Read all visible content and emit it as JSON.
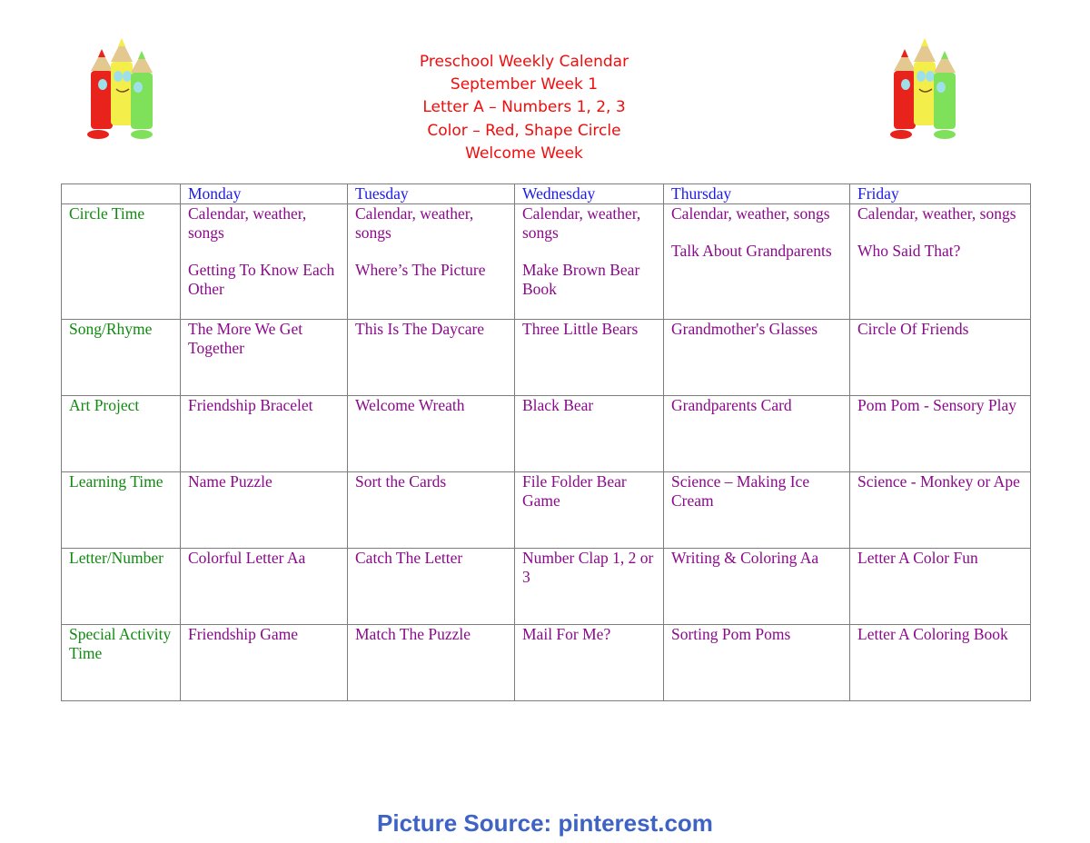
{
  "header": {
    "title_lines": [
      "Preschool Weekly Calendar",
      "September Week 1",
      "Letter A – Numbers 1, 2, 3",
      "Color – Red, Shape Circle",
      "Welcome Week"
    ],
    "left_image": "crayon-characters-icon",
    "right_image": "crayon-characters-icon"
  },
  "colors": {
    "title": "#f20c0c",
    "day_header": "#1a1aef",
    "row_label": "#118a11",
    "cell_text": "#8b0a8b",
    "footer": "#3e63c5"
  },
  "table": {
    "days": [
      "Monday",
      "Tuesday",
      "Wednesday",
      "Thursday",
      "Friday"
    ],
    "rows": [
      {
        "label": "Circle Time",
        "cells": [
          [
            "Calendar, weather, songs",
            "Getting To Know Each Other"
          ],
          [
            "Calendar, weather, songs",
            "Where’s The Picture"
          ],
          [
            "Calendar, weather, songs",
            "Make Brown Bear Book"
          ],
          [
            "Calendar, weather, songs",
            "Talk About Grandparents"
          ],
          [
            "Calendar, weather, songs",
            "Who Said That?"
          ]
        ]
      },
      {
        "label": "Song/Rhyme",
        "cells": [
          [
            "The More We Get Together"
          ],
          [
            "This Is The Daycare"
          ],
          [
            "Three Little Bears"
          ],
          [
            "Grandmother's Glasses"
          ],
          [
            "Circle Of Friends"
          ]
        ]
      },
      {
        "label": "Art Project",
        "cells": [
          [
            "Friendship Bracelet"
          ],
          [
            "Welcome Wreath"
          ],
          [
            "Black Bear"
          ],
          [
            "Grandparents Card"
          ],
          [
            "Pom Pom - Sensory Play"
          ]
        ]
      },
      {
        "label": "Learning Time",
        "cells": [
          [
            "Name Puzzle"
          ],
          [
            "Sort the Cards"
          ],
          [
            "File Folder Bear Game"
          ],
          [
            "Science – Making Ice Cream"
          ],
          [
            "Science - Monkey or Ape"
          ]
        ]
      },
      {
        "label": "Letter/Number",
        "cells": [
          [
            "Colorful Letter Aa"
          ],
          [
            "Catch The Letter"
          ],
          [
            "Number Clap 1, 2 or 3"
          ],
          [
            "Writing & Coloring Aa"
          ],
          [
            "Letter A Color Fun"
          ]
        ]
      },
      {
        "label": "Special Activity Time",
        "cells": [
          [
            "Friendship Game"
          ],
          [
            "Match The Puzzle"
          ],
          [
            "Mail For Me?"
          ],
          [
            "Sorting Pom Poms"
          ],
          [
            "Letter A Coloring Book"
          ]
        ]
      }
    ]
  },
  "footer": {
    "source": "Picture Source: pinterest.com"
  }
}
